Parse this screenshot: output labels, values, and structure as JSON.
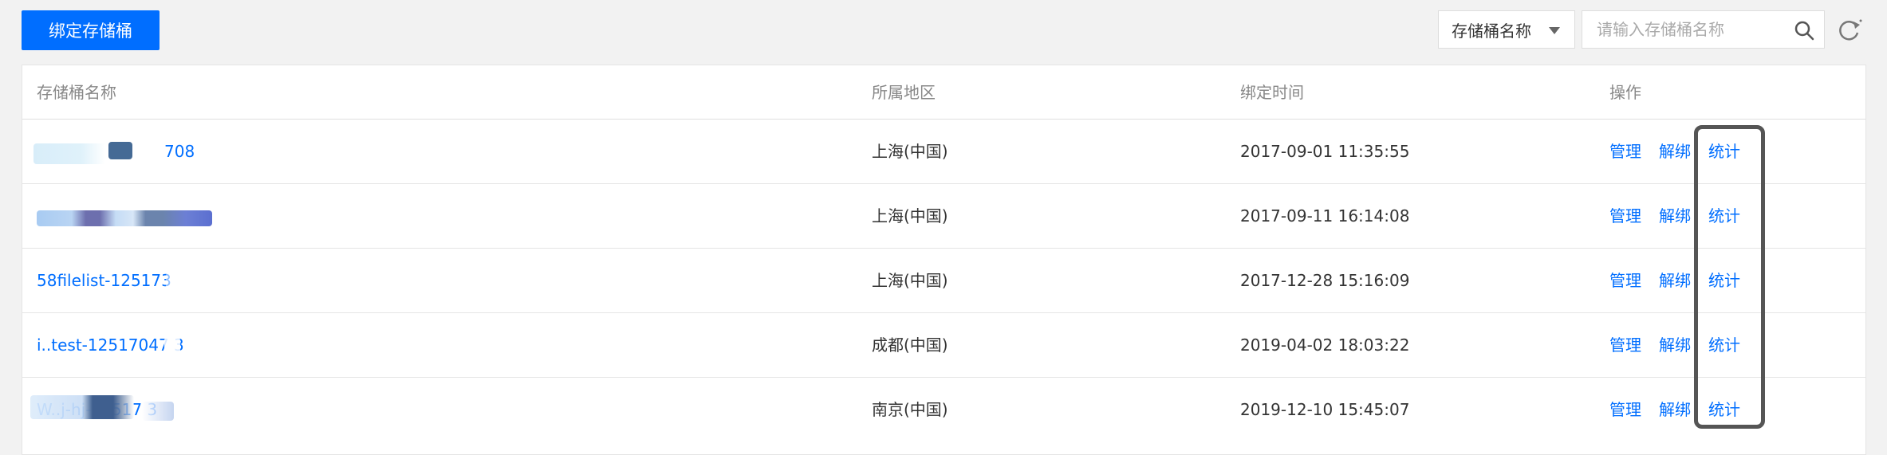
{
  "toolbar": {
    "bind_button_label": "绑定存储桶",
    "filter_select_value": "存储桶名称",
    "search_placeholder": "请输入存储桶名称"
  },
  "table": {
    "columns": [
      "存储桶名称",
      "所属地区",
      "绑定时间",
      "操作"
    ],
    "actions": [
      "管理",
      "解绑",
      "统计"
    ],
    "rows": [
      {
        "name": "708",
        "region": "上海(中国)",
        "time": "2017-09-01 11:35:55"
      },
      {
        "name": "",
        "region": "上海(中国)",
        "time": "2017-09-11 16:14:08"
      },
      {
        "name": "58filelist-125173",
        "region": "上海(中国)",
        "time": "2017-12-28 15:16:09"
      },
      {
        "name": "i..test-12517047  3",
        "region": "成都(中国)",
        "time": "2019-04-02 18:03:22"
      },
      {
        "name": "W..j-hj-12517   3",
        "region": "南京(中国)",
        "time": "2019-12-10 15:45:07"
      }
    ]
  },
  "colors": {
    "primary": "#006eff",
    "background": "#f2f2f2",
    "highlight_border": "#555555"
  }
}
